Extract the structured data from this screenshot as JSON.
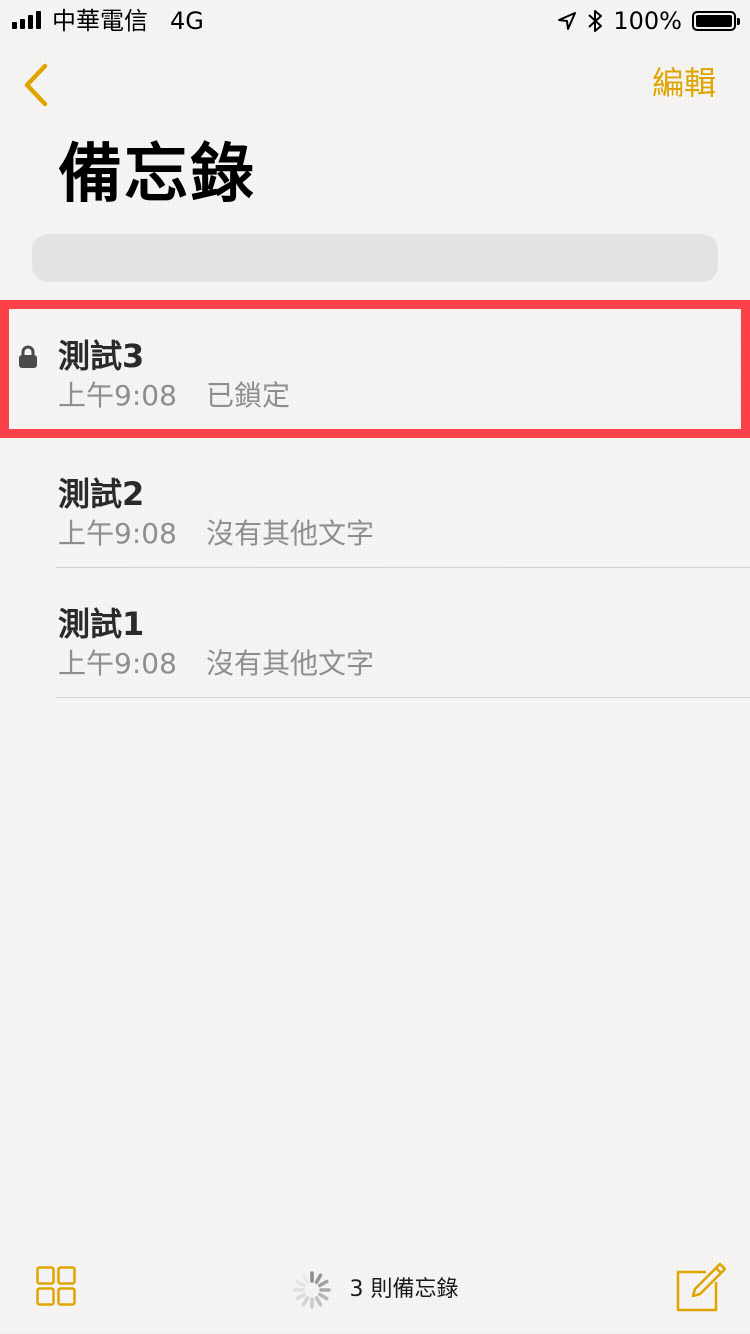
{
  "status_bar": {
    "carrier": "中華電信",
    "network": "4G",
    "battery_percent": "100%",
    "signal_bars": 4,
    "icons": [
      "signal-icon",
      "location-arrow-icon",
      "bluetooth-icon",
      "battery-icon"
    ]
  },
  "nav": {
    "back_icon": "chevron-left-icon",
    "edit_label": "編輯",
    "accent_color": "#e0a400"
  },
  "title": "備忘錄",
  "search": {
    "placeholder": ""
  },
  "notes": [
    {
      "title": "測試3",
      "time": "上午9:08",
      "preview": "已鎖定",
      "locked": true,
      "selected": true
    },
    {
      "title": "測試2",
      "time": "上午9:08",
      "preview": "沒有其他文字",
      "locked": false,
      "selected": false
    },
    {
      "title": "測試1",
      "time": "上午9:08",
      "preview": "沒有其他文字",
      "locked": false,
      "selected": false
    }
  ],
  "toolbar": {
    "gallery_icon": "grid-icon",
    "count_text": "3 則備忘錄",
    "loading_icon": "spinner-icon",
    "compose_icon": "compose-icon"
  },
  "colors": {
    "accent": "#e0a400",
    "highlight": "#fb4149",
    "secondary_text": "#8e8e8e"
  }
}
